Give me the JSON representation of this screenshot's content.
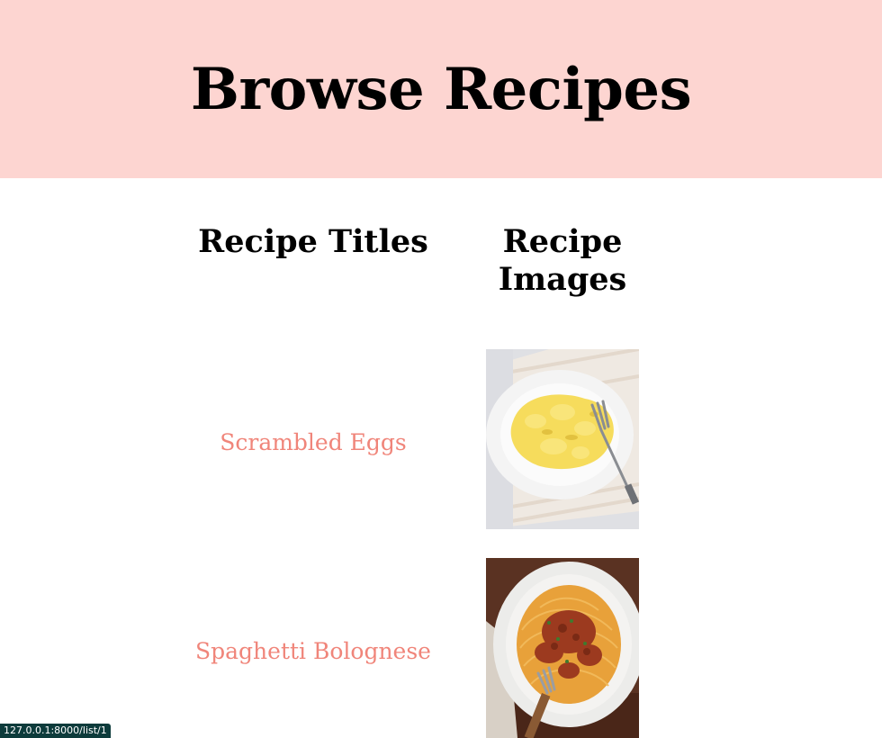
{
  "header": {
    "title": "Browse Recipes",
    "background_color": "#fdd5d1"
  },
  "table": {
    "headers": {
      "titles": "Recipe Titles",
      "images": "Recipe Images"
    },
    "link_color": "#f0857a",
    "rows": [
      {
        "title": "Scrambled Eggs",
        "image": "scrambled-eggs-photo"
      },
      {
        "title": "Spaghetti Bolognese",
        "image": "spaghetti-bolognese-photo"
      }
    ]
  },
  "status_bar": {
    "url": "127.0.0.1:8000/list/1"
  }
}
